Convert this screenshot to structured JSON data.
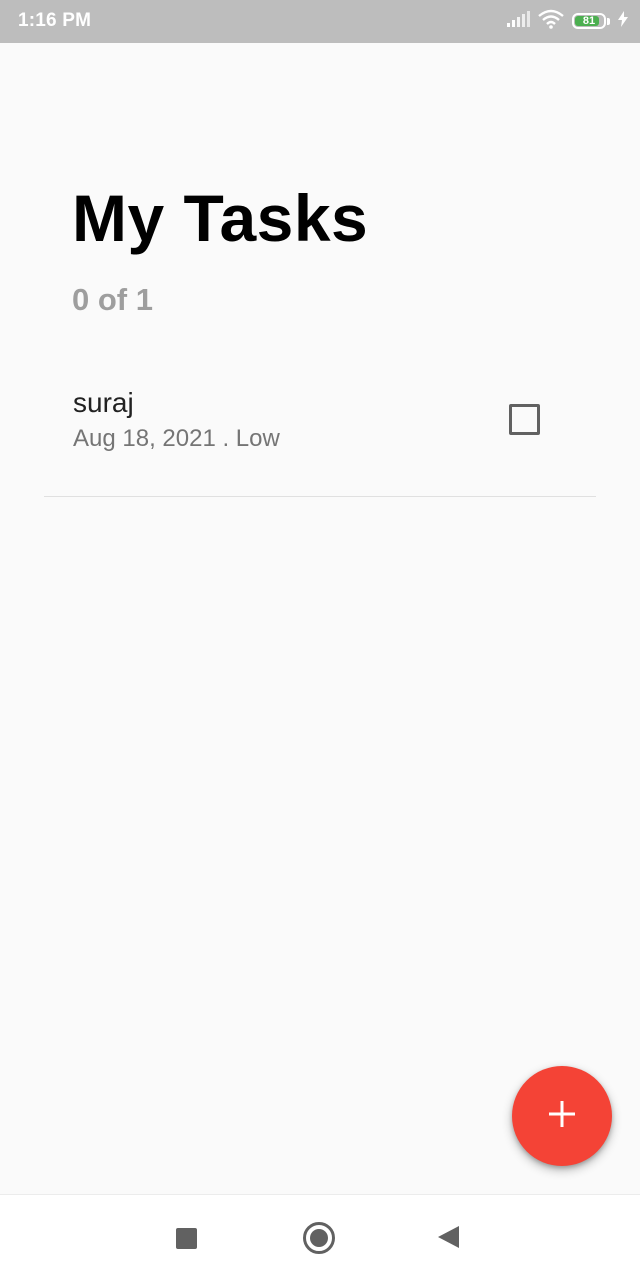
{
  "status_bar": {
    "time": "1:16 PM",
    "battery_level": "81",
    "icons": [
      "signal-icon",
      "wifi-icon",
      "battery-icon",
      "charging-bolt-icon"
    ]
  },
  "header": {
    "title": "My Tasks",
    "count": "0 of 1"
  },
  "tasks": [
    {
      "title": "suraj",
      "meta": "Aug 18, 2021 . Low",
      "completed": false
    }
  ],
  "fab": {
    "icon": "plus-icon",
    "color": "#f44336"
  },
  "nav_bar": {
    "icons": [
      "recents-square-icon",
      "home-circle-icon",
      "back-triangle-icon"
    ]
  }
}
